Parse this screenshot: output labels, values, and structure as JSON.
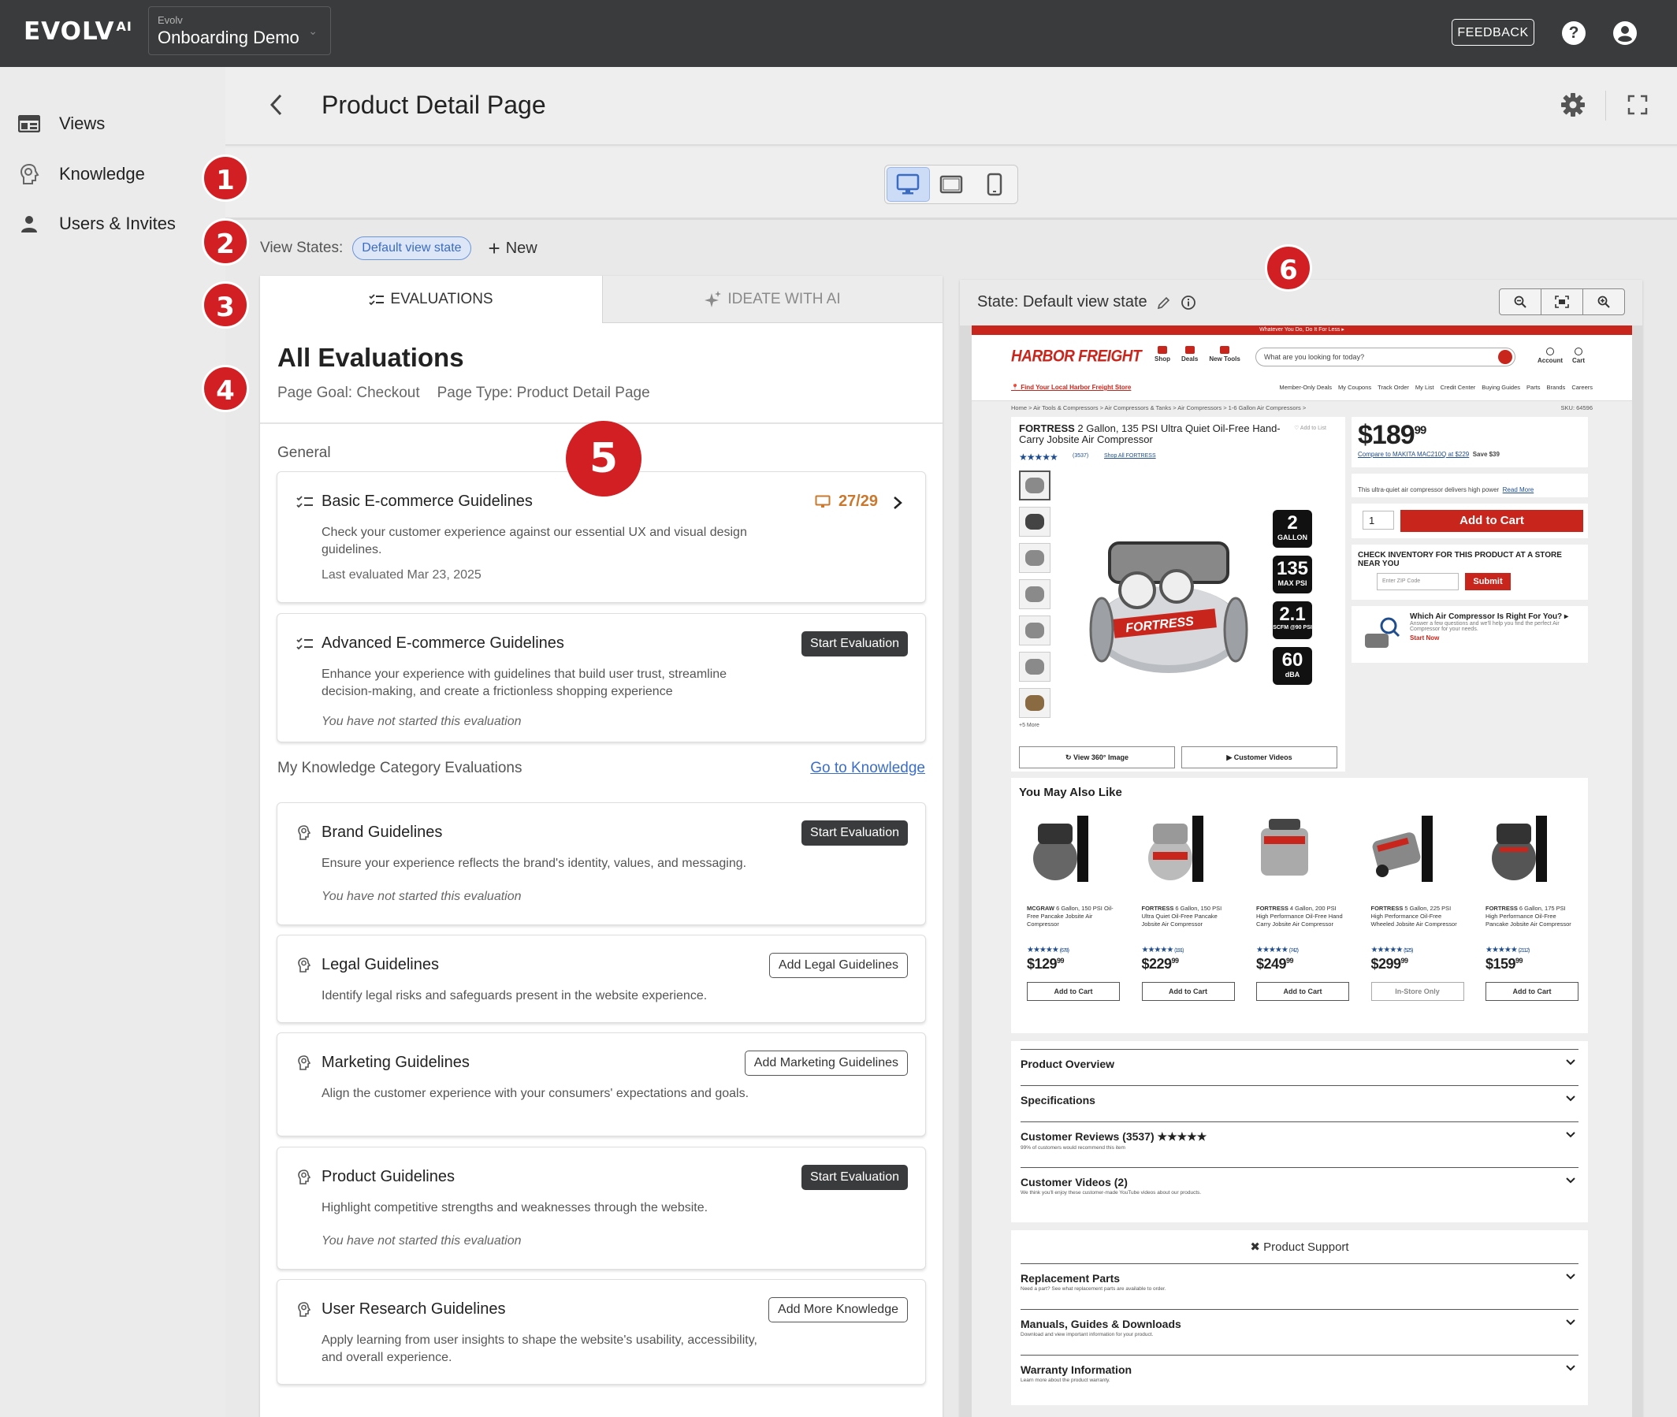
{
  "app": {
    "logo_text": "EVOLV",
    "logo_sup": "AI",
    "org_label": "Evolv",
    "org_name": "Onboarding Demo",
    "feedback_label": "FEEDBACK",
    "help_glyph": "?"
  },
  "sidebar": {
    "items": [
      {
        "label": "Views",
        "icon": "views-icon"
      },
      {
        "label": "Knowledge",
        "icon": "knowledge-icon"
      },
      {
        "label": "Users & Invites",
        "icon": "person-icon"
      }
    ]
  },
  "header": {
    "title": "Product Detail Page"
  },
  "devices": {
    "active": "desktop",
    "options": [
      "desktop",
      "tablet",
      "mobile"
    ]
  },
  "view_states": {
    "label": "View States:",
    "chip": "Default view state",
    "new_label": "New",
    "new_glyph": "+"
  },
  "markers": [
    "1",
    "2",
    "3",
    "4",
    "5",
    "6"
  ],
  "evaluations": {
    "tab_evaluations": "EVALUATIONS",
    "tab_ideate": "IDEATE WITH AI",
    "title": "All Evaluations",
    "page_goal": "Page Goal: Checkout",
    "page_type": "Page Type: Product Detail Page",
    "general_label": "General",
    "knowledge_label": "My Knowledge Category Evaluations",
    "knowledge_link": "Go to Knowledge",
    "cards": [
      {
        "title": "Basic E-commerce Guidelines",
        "desc": "Check your customer experience against our essential UX and visual design guidelines.",
        "note": "Last evaluated Mar 23, 2025",
        "score": "27/29"
      },
      {
        "title": "Advanced E-commerce Guidelines",
        "desc": "Enhance your experience with guidelines that build user trust, streamline decision-making, and create a frictionless shopping experience",
        "note": "You have not started this evaluation",
        "button": "Start Evaluation"
      },
      {
        "title": "Brand Guidelines",
        "desc": "Ensure your experience reflects the brand's identity, values, and messaging.",
        "note": "You have not started this evaluation",
        "button": "Start Evaluation"
      },
      {
        "title": "Legal Guidelines",
        "desc": "Identify legal risks and safeguards present in the website experience.",
        "button": "Add Legal Guidelines"
      },
      {
        "title": "Marketing Guidelines",
        "desc": "Align the customer experience with your consumers' expectations and goals.",
        "button": "Add Marketing Guidelines"
      },
      {
        "title": "Product Guidelines",
        "desc": "Highlight competitive strengths and weaknesses through the website.",
        "note": "You have not started this evaluation",
        "button": "Start Evaluation"
      },
      {
        "title": "User Research Guidelines",
        "desc": "Apply learning from user insights to shape the website's usability, accessibility, and overall experience.",
        "button": "Add More Knowledge"
      }
    ]
  },
  "preview": {
    "state_label": "State: Default view state",
    "site": {
      "banner": "Whatever You Do, Do It For Less ▸",
      "logo": "HARBOR FREIGHT",
      "nav_icons": [
        "Shop",
        "Deals",
        "New Tools"
      ],
      "search_placeholder": "What are you looking for today?",
      "account_items": [
        "Account",
        "Cart"
      ],
      "store_link": "Find Your Local Harbor Freight Store",
      "nav_links": [
        "Member-Only Deals",
        "My Coupons",
        "Track Order",
        "My List",
        "Credit Center",
        "Buying Guides",
        "Parts",
        "Brands",
        "Careers"
      ],
      "breadcrumb": "Home  >  Air Tools & Compressors  >  Air Compressors & Tanks  >  Air Compressors  >  1-6 Gallon Air Compressors  >",
      "sku": "SKU: 64596",
      "product_brand": "FORTRESS",
      "product_title": " 2 Gallon, 135 PSI Ultra Quiet Oil-Free Hand-Carry Jobsite Air Compressor",
      "add_to_list": "♡ Add to List",
      "stars": "★★★★★",
      "review_count": "(3537)",
      "shop_all": "Shop All FORTRESS",
      "more_thumbs": "+5 More",
      "specs": [
        {
          "n": "2",
          "u": "GALLON"
        },
        {
          "n": "135",
          "u": "MAX PSI"
        },
        {
          "n": "2.1",
          "u": "SCFM @90 PSI"
        },
        {
          "n": "60",
          "u": "dBA"
        }
      ],
      "view360": "View 360° Image",
      "customer_videos": "Customer Videos",
      "price_dollars": "$189",
      "price_cents": "99",
      "compare_text": "Compare to MAKITA MAC210Q at $229",
      "save_text": "Save $39",
      "promo_text": "This ultra-quiet air compressor delivers high power",
      "read_more": "Read More",
      "qty": "1",
      "add_to_cart": "Add to Cart",
      "check_inventory": "CHECK INVENTORY FOR THIS PRODUCT AT A STORE NEAR YOU",
      "zip_placeholder": "Enter ZIP Code",
      "submit": "Submit",
      "which_title": "Which Air Compressor Is Right For You? ▸",
      "which_desc": "Answer a few questions and we'll help you find the perfect Air Compressor for your needs.",
      "start_now": "Start Now",
      "ymal_title": "You May Also Like",
      "ymal": [
        {
          "brand": "MCGRAW",
          "name": " 6 Gallon, 150 PSI Oil-Free Pancake Jobsite Air Compressor",
          "reviews": "(678)",
          "dollars": "$129",
          "cents": "99",
          "btn": "Add to Cart"
        },
        {
          "brand": "FORTRESS",
          "name": " 6 Gallon, 150 PSI Ultra Quiet Oil-Free Pancake Jobsite Air Compressor",
          "reviews": "(191)",
          "dollars": "$229",
          "cents": "99",
          "btn": "Add to Cart"
        },
        {
          "brand": "FORTRESS",
          "name": " 4 Gallon, 200 PSI High Performance Oil-Free Hand Carry Jobsite Air Compressor",
          "reviews": "(742)",
          "dollars": "$249",
          "cents": "99",
          "btn": "Add to Cart"
        },
        {
          "brand": "FORTRESS",
          "name": " 5 Gallon, 225 PSI High Performance Oil-Free Wheeled Jobsite Air Compressor",
          "reviews": "(525)",
          "dollars": "$299",
          "cents": "99",
          "btn": "In-Store Only"
        },
        {
          "brand": "FORTRESS",
          "name": " 6 Gallon, 175 PSI High Performance Oil-Free Pancake Jobsite Air Compressor",
          "reviews": "(2112)",
          "dollars": "$159",
          "cents": "99",
          "btn": "Add to Cart"
        }
      ],
      "accordion1": [
        {
          "title": "Product Overview",
          "sub": ""
        },
        {
          "title": "Specifications",
          "sub": ""
        },
        {
          "title": "Customer Reviews (3537) ★★★★★",
          "sub": "99% of customers would recommend this item"
        },
        {
          "title": "Customer Videos (2)",
          "sub": "We think you'll enjoy these customer-made YouTube videos about our products."
        }
      ],
      "support_title": "Product Support",
      "accordion2": [
        {
          "title": "Replacement Parts",
          "sub": "Need a part? See what replacement parts are available to order."
        },
        {
          "title": "Manuals, Guides & Downloads",
          "sub": "Download and view important information for your product."
        },
        {
          "title": "Warranty Information",
          "sub": "Learn more about the product warranty."
        }
      ]
    }
  }
}
